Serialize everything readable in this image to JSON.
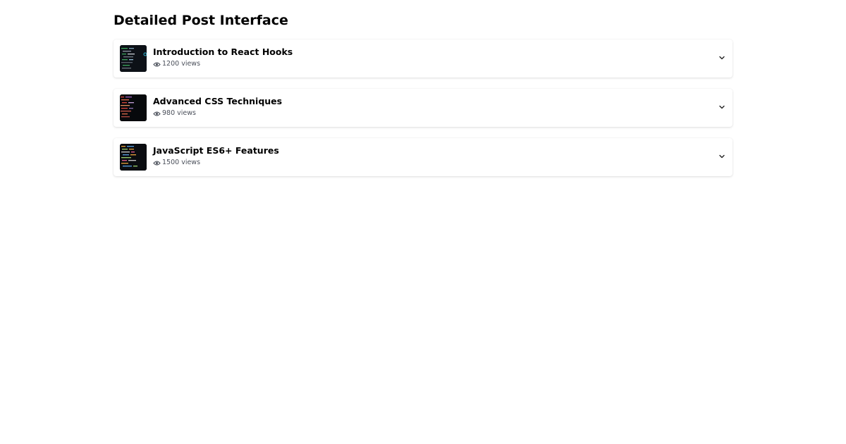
{
  "page": {
    "title": "Detailed Post Interface"
  },
  "posts": [
    {
      "title": "Introduction to React Hooks",
      "views": "1200 views",
      "thumbnail_icon": "code-screenshot-green"
    },
    {
      "title": "Advanced CSS Techniques",
      "views": "980 views",
      "thumbnail_icon": "code-screenshot-red"
    },
    {
      "title": "JavaScript ES6+ Features",
      "views": "1500 views",
      "thumbnail_icon": "code-screenshot-orange"
    }
  ],
  "icons": {
    "views": "eye-icon",
    "expand": "chevron-down-icon"
  },
  "colors": {
    "background": "#ffffff",
    "title": "#000000",
    "meta_text": "#4a4f5a"
  }
}
